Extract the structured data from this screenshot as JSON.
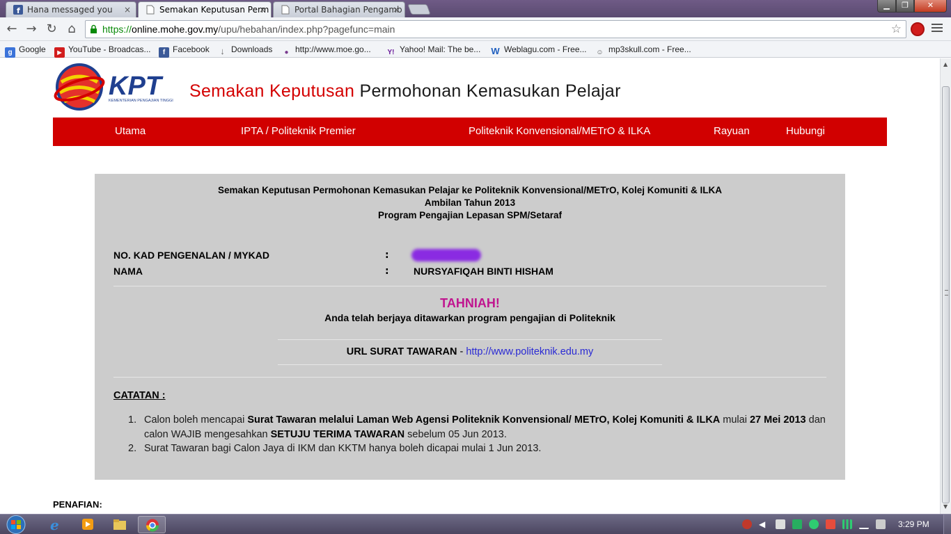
{
  "browser": {
    "tabs": [
      {
        "title": "Hana messaged you",
        "active": false,
        "icon": "facebook-icon"
      },
      {
        "title": "Semakan Keputusan Perm",
        "active": true,
        "icon": "page-icon"
      },
      {
        "title": "Portal Bahagian Pengamb",
        "active": false,
        "icon": "page-icon"
      }
    ],
    "tab_close_glyph": "×",
    "url": {
      "scheme": "https://",
      "host": "online.mohe.gov.my",
      "path": "/upu/hebahan/index.php?pagefunc=main"
    },
    "bookmarks": [
      {
        "label": "Google",
        "icon": "google-icon",
        "color": "#3b73d9",
        "glyph": "g"
      },
      {
        "label": "YouTube - Broadcas...",
        "icon": "youtube-icon",
        "color": "#d21d1d",
        "glyph": "▶"
      },
      {
        "label": "Facebook",
        "icon": "facebook-icon",
        "color": "#3b5998",
        "glyph": "f"
      },
      {
        "label": "Downloads",
        "icon": "download-icon",
        "color": "#6e6e6e",
        "glyph": "↓"
      },
      {
        "label": "http://www.moe.go...",
        "icon": "moe-icon",
        "color": "#7a3b8f",
        "glyph": "●"
      },
      {
        "label": "Yahoo! Mail: The be...",
        "icon": "yahoo-icon",
        "color": "#6a1b9a",
        "glyph": "Y!"
      },
      {
        "label": "Weblagu.com - Free...",
        "icon": "weblagu-icon",
        "color": "#1f5fbf",
        "glyph": "W"
      },
      {
        "label": "mp3skull.com - Free...",
        "icon": "mp3skull-icon",
        "color": "#555555",
        "glyph": "☺"
      }
    ]
  },
  "site": {
    "logo_text": "KPT",
    "logo_subtext": "KEMENTERIAN PENGAJIAN TINGGI",
    "title_red": "Semakan Keputusan",
    "title_dark": " Permohonan Kemasukan Pelajar",
    "nav": [
      "Utama",
      "IPTA / Politeknik Premier",
      "Politeknik Konvensional/METrO & ILKA",
      "Rayuan",
      "Hubungi"
    ]
  },
  "result": {
    "heading_1": "Semakan Keputusan Permohonan Kemasukan Pelajar ke Politeknik Konvensional/METrO, Kolej Komuniti & ILKA",
    "heading_2": "Ambilan Tahun 2013",
    "heading_3": "Program Pengajian Lepasan SPM/Setaraf",
    "ic_label": "NO. KAD PENGENALAN / MYKAD",
    "name_label": "NAMA",
    "colon": ":",
    "name_value": "NURSYAFIQAH BINTI HISHAM",
    "congrats": "TAHNIAH!",
    "offer_message": "Anda telah berjaya ditawarkan program pengajian di Politeknik",
    "offer_url_label": "URL SURAT TAWARAN",
    "offer_url_sep": " - ",
    "offer_url": "http://www.politeknik.edu.my",
    "notes_title": "CATATAN :",
    "notes": [
      {
        "num": "1.",
        "t1": "Calon boleh mencapai ",
        "b1": "Surat Tawaran melalui Laman Web Agensi Politeknik Konvensional/ METrO, Kolej Komuniti & ILKA",
        "t2": " mulai ",
        "b2": "27 Mei 2013",
        "t3": " dan calon WAJIB mengesahkan ",
        "b3": "SETUJU TERIMA TAWARAN",
        "t4": " sebelum 05 Jun 2013."
      },
      {
        "num": "2.",
        "t1": "Surat Tawaran bagi Calon Jaya di IKM dan KKTM hanya boleh dicapai mulai 1 Jun 2013."
      }
    ]
  },
  "footer": {
    "disclaimer_title": "PENAFIAN:"
  },
  "taskbar": {
    "clock": "3:29 PM"
  },
  "colors": {
    "nav_red": "#d10000",
    "congrats_magenta": "#c0158f",
    "box_gray": "#cccccc",
    "link_blue": "#2a2ad4"
  }
}
